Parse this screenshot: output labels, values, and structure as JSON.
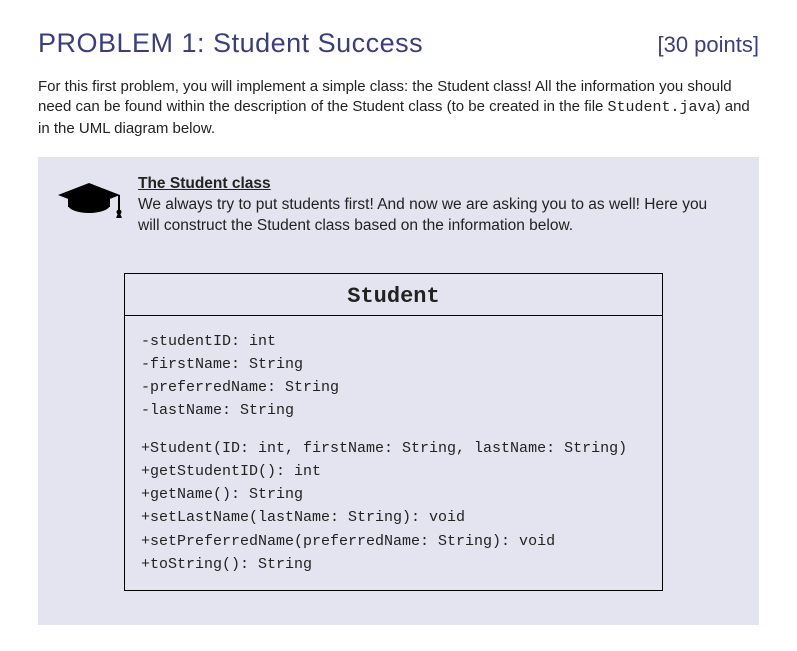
{
  "header": {
    "title": "PROBLEM 1: Student Success",
    "points": "[30 points]"
  },
  "intro": {
    "part1": "For this first problem, you will implement a simple class: the Student class! All the information you should need can be found within the description of the Student class (to be created in the file ",
    "filename": "Student.java",
    "part2": ") and in the UML diagram below."
  },
  "panel": {
    "heading": "The Student class",
    "desc": "We always try to put students first! And now we are asking you to as well! Here you will construct the Student class based on the information below.",
    "icon_name": "graduation-cap-icon"
  },
  "uml": {
    "class_name": "Student",
    "fields": [
      "-studentID: int",
      "-firstName: String",
      "-preferredName: String",
      "-lastName: String"
    ],
    "methods": [
      "+Student(ID: int, firstName: String, lastName: String)",
      "+getStudentID(): int",
      "+getName(): String",
      "+setLastName(lastName: String): void",
      "+setPreferredName(preferredName: String): void",
      "+toString(): String"
    ]
  }
}
